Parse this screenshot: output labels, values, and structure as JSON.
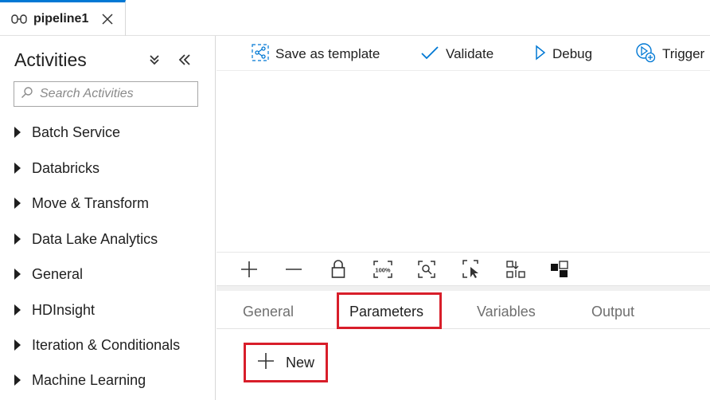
{
  "tab": {
    "label": "pipeline1",
    "icon": "pipeline-icon"
  },
  "activities": {
    "title": "Activities",
    "search_placeholder": "Search Activities",
    "categories": [
      {
        "label": "Batch Service"
      },
      {
        "label": "Databricks"
      },
      {
        "label": "Move & Transform"
      },
      {
        "label": "Data Lake Analytics"
      },
      {
        "label": "General"
      },
      {
        "label": "HDInsight"
      },
      {
        "label": "Iteration & Conditionals"
      },
      {
        "label": "Machine Learning"
      }
    ]
  },
  "toolbar": {
    "save_template": "Save as template",
    "validate": "Validate",
    "debug": "Debug",
    "trigger": "Trigger"
  },
  "canvas_tools": {
    "zoom_label": "100%"
  },
  "panel_tabs": [
    {
      "label": "General"
    },
    {
      "label": "Parameters"
    },
    {
      "label": "Variables"
    },
    {
      "label": "Output"
    }
  ],
  "new_button": {
    "label": "New"
  },
  "colors": {
    "accent": "#0078d4",
    "highlight": "#d81e2a",
    "text": "#1f1f1f",
    "muted": "#6f6f6f"
  }
}
